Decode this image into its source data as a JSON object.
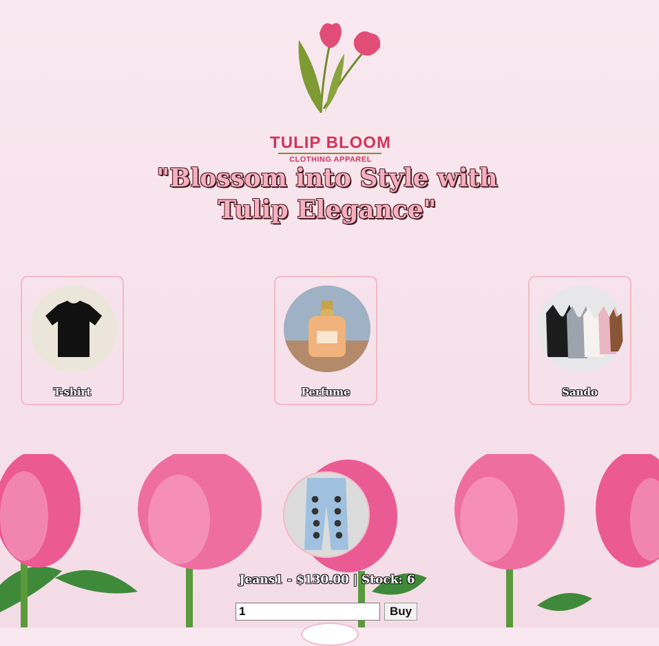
{
  "brand": {
    "name": "TULIP BLOOM",
    "subtitle": "CLOTHING APPAREL"
  },
  "tagline": "\"Blossom into Style with Tulip Elegance\"",
  "categories": [
    {
      "label": "T-shirt",
      "icon": "tshirt-image"
    },
    {
      "label": "Perfume",
      "icon": "perfume-image"
    },
    {
      "label": "Sando",
      "icon": "sando-image"
    }
  ],
  "product": {
    "info": "Jeans1 - $130.00 | Stock: 6",
    "quantity": "1",
    "buy_label": "Buy"
  },
  "colors": {
    "accent": "#d2345b",
    "card_border": "#f4b8c6",
    "tagline_fill": "#f6b0bf"
  }
}
